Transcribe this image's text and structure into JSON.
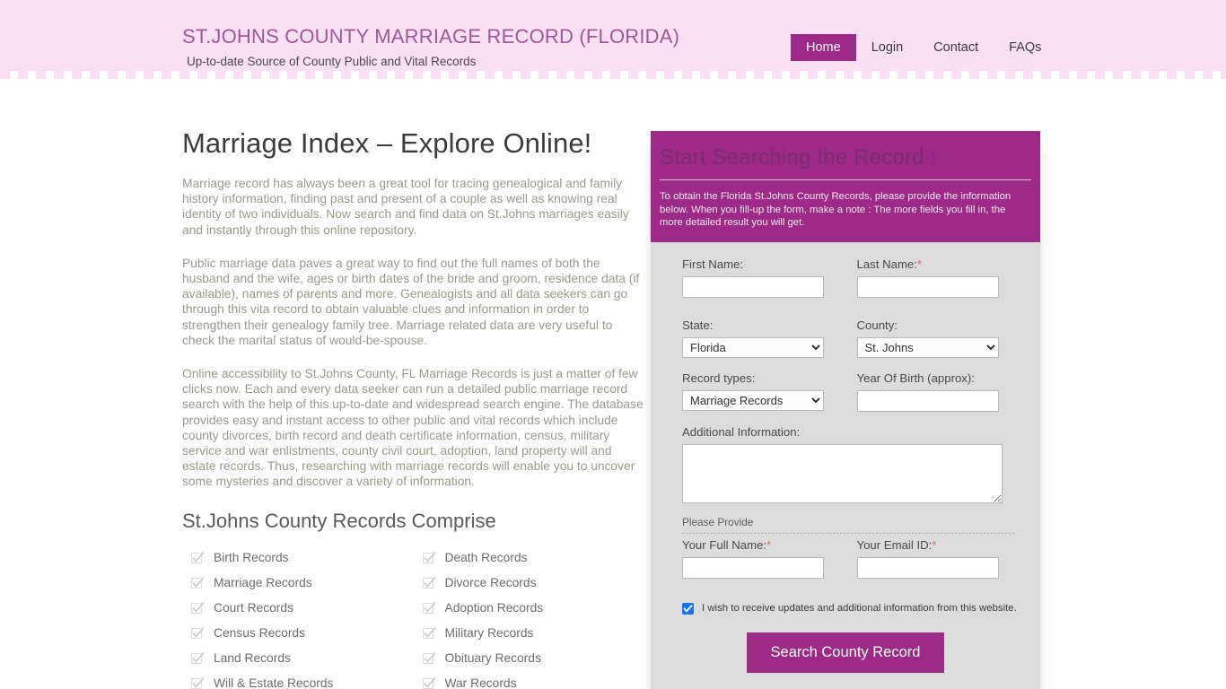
{
  "header": {
    "brand_title": "ST.JOHNS COUNTY MARRIAGE RECORD (FLORIDA)",
    "brand_tagline": "Up-to-date Source of  County Public and Vital Records",
    "nav": [
      {
        "label": "Home",
        "active": true
      },
      {
        "label": "Login",
        "active": false
      },
      {
        "label": "Contact",
        "active": false
      },
      {
        "label": "FAQs",
        "active": false
      }
    ]
  },
  "main": {
    "title": "Marriage Index – Explore Online!",
    "paragraphs": [
      "Marriage record has always been a great tool for tracing genealogical and family history information, finding past and present of a couple as well as knowing real identity of two individuals. Now search and find data on St.Johns marriages easily and instantly through this online repository.",
      "Public marriage data paves a great way to find out the full names of both the husband and the wife, ages or birth dates of the bride and groom, residence data (if available), names of parents and more. Genealogists and all data seekers can go through this vita record to obtain valuable clues and information in order to strengthen their genealogy family tree. Marriage related data are very useful to check the marital status of would-be-spouse.",
      "Online accessibility to St.Johns County, FL Marriage Records is just a matter of few clicks now. Each and every data seeker can run a detailed public marriage record search with the help of this up-to-date and widespread search engine. The database provides easy and instant access to other public and vital records which include county divorces, birth record and death certificate information, census, military service and war enlistments, county civil court, adoption, land property will and estate records. Thus, researching with marriage records will enable you to uncover some mysteries and discover a variety of information."
    ],
    "records_heading": "St.Johns County Records Comprise",
    "records": [
      "Birth Records",
      "Death Records",
      "Marriage Records",
      "Divorce Records",
      "Court Records",
      "Adoption Records",
      "Census Records",
      "Military Records",
      "Land Records",
      "Obituary Records",
      "Will & Estate Records",
      "War Records"
    ]
  },
  "form": {
    "heading": "Start Searching the Record :",
    "intro": "To obtain the Florida St.Johns County Records, please provide the information below. When you fill-up the form, make a note : The more fields you fill in, the more detailed result you will get.",
    "first_name_label": "First Name:",
    "first_name_value": "",
    "last_name_label": "Last Name:",
    "last_name_required": "*",
    "last_name_value": "",
    "state_label": "State:",
    "state_value": "Florida",
    "county_label": "County:",
    "county_value": "St. Johns",
    "record_types_label": "Record types:",
    "record_types_value": "Marriage Records",
    "year_label": "Year Of Birth (approx):",
    "year_value": "",
    "additional_label": "Additional Information:",
    "additional_value": "",
    "please_provide": "Please Provide",
    "full_name_label": "Your Full Name:",
    "full_name_required": "*",
    "full_name_value": "",
    "email_label": "Your Email ID:",
    "email_required": "*",
    "email_value": "",
    "optin_text": "I wish to receive updates and additional information from this website.",
    "optin_checked": true,
    "submit_label": "Search County Record"
  },
  "colors": {
    "header_pink": "#fbdff5",
    "accent_magenta": "#9c2a86",
    "panel_gray": "#dcdcdc",
    "body_text": "#9a9a8e",
    "required_red": "#e0666e",
    "checkbox_blue": "#1a73e8"
  }
}
